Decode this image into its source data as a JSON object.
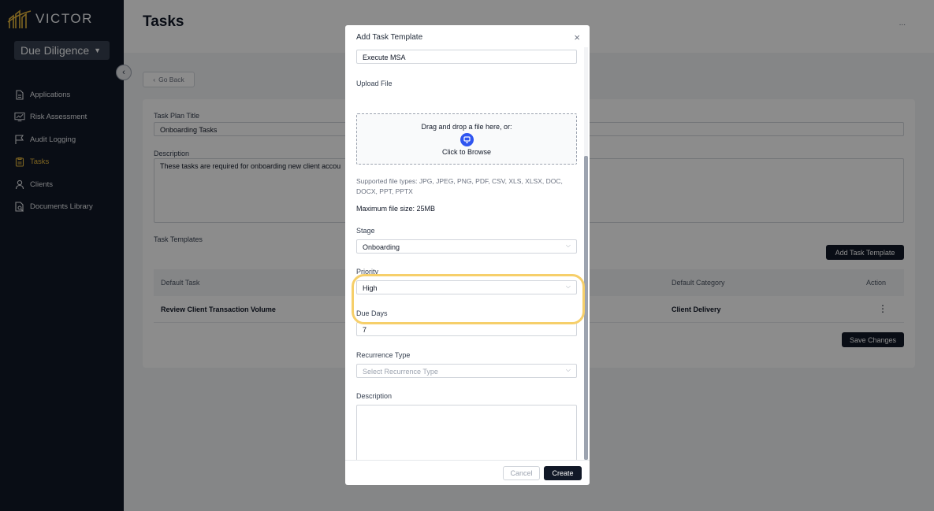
{
  "brand": {
    "name": "VICTOR",
    "accent": "#e8b93c"
  },
  "workspace": {
    "label": "Due Diligence"
  },
  "sidebar": {
    "items": [
      {
        "label": "Applications",
        "icon": "document-icon",
        "active": false
      },
      {
        "label": "Risk Assessment",
        "icon": "chart-monitor-icon",
        "active": false
      },
      {
        "label": "Audit Logging",
        "icon": "flag-icon",
        "active": false
      },
      {
        "label": "Tasks",
        "icon": "clipboard-icon",
        "active": true
      },
      {
        "label": "Clients",
        "icon": "user-icon",
        "active": false
      },
      {
        "label": "Documents Library",
        "icon": "document-search-icon",
        "active": false
      }
    ]
  },
  "page": {
    "title": "Tasks",
    "more": "...",
    "go_back": "Go Back",
    "task_plan_title_label": "Task Plan Title",
    "task_plan_title_value": "Onboarding Tasks",
    "description_label": "Description",
    "description_value": "These tasks are required for onboarding new client accou",
    "task_templates_label": "Task Templates",
    "add_task_template": "Add Task Template",
    "save_changes": "Save Changes",
    "table": {
      "headers": {
        "default_task": "Default Task",
        "default_category": "Default Category",
        "action": "Action"
      },
      "rows": [
        {
          "task": "Review Client Transaction Volume",
          "category": "Client Delivery",
          "action": "⋮"
        }
      ]
    }
  },
  "modal": {
    "title": "Add Task Template",
    "close": "×",
    "task_name_value": "Execute MSA",
    "upload_label": "Upload File",
    "dropzone_text": "Drag and drop a file here, or:",
    "browse_text": "Click to Browse",
    "supported_types": "Supported file types: JPG, JPEG, PNG, PDF, CSV, XLS, XLSX, DOC, DOCX, PPT, PPTX",
    "max_size": "Maximum file size: 25MB",
    "stage_label": "Stage",
    "stage_value": "Onboarding",
    "priority_label": "Priority",
    "priority_value": "High",
    "due_days_label": "Due Days",
    "due_days_value": "7",
    "recurrence_label": "Recurrence Type",
    "recurrence_placeholder": "Select Recurrence Type",
    "description_label": "Description",
    "cancel": "Cancel",
    "create": "Create"
  }
}
